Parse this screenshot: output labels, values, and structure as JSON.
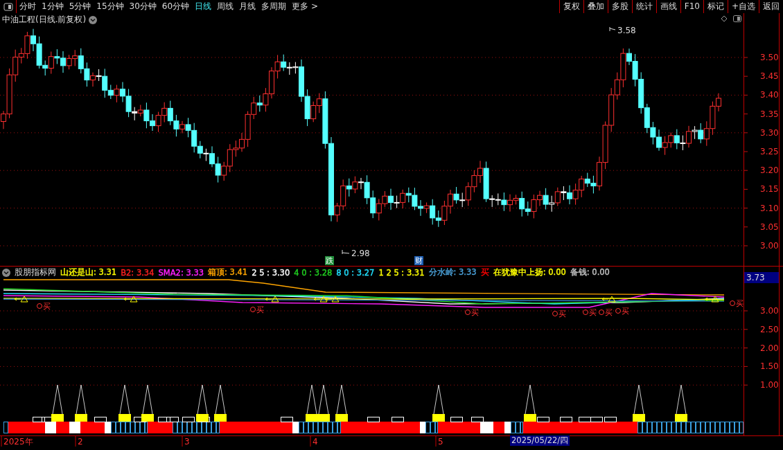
{
  "toolbar": {
    "periods": [
      {
        "label": "分时",
        "selected": false
      },
      {
        "label": "1分钟",
        "selected": false
      },
      {
        "label": "5分钟",
        "selected": false
      },
      {
        "label": "15分钟",
        "selected": false
      },
      {
        "label": "30分钟",
        "selected": false
      },
      {
        "label": "60分钟",
        "selected": false
      },
      {
        "label": "日线",
        "selected": true
      },
      {
        "label": "周线",
        "selected": false
      },
      {
        "label": "月线",
        "selected": false
      },
      {
        "label": "多周期",
        "selected": false
      },
      {
        "label": "更多 >",
        "selected": false
      }
    ],
    "buttons": [
      "复权",
      "叠加",
      "多股",
      "统计",
      "画线",
      "F10",
      "标记",
      "+自选",
      "返回"
    ]
  },
  "main_chart": {
    "title": "中油工程(日线.前复权)",
    "price_axis": [
      "3.50",
      "3.45",
      "3.40",
      "3.35",
      "3.30",
      "3.25",
      "3.20",
      "3.15",
      "3.10",
      "3.05",
      "3.00"
    ],
    "high_label": "3.58",
    "low_label": "2.98",
    "badges": [
      {
        "text": "跌",
        "color": "#1f8f3a"
      },
      {
        "text": "财",
        "color": "#1e5fb4"
      }
    ]
  },
  "indicator": {
    "name": "股朋指标网",
    "legend": [
      {
        "text": "山还是山: 3.31",
        "color": "#ffff00"
      },
      {
        "text": "B2: 3.34",
        "color": "#ff2020"
      },
      {
        "text": "SMA2: 3.33",
        "color": "#ff20ff"
      },
      {
        "text": "箱顶: 3.41",
        "color": "#ffa500"
      },
      {
        "text": "2 5 : 3.30",
        "color": "#ffffff"
      },
      {
        "text": "4 0 : 3.28",
        "color": "#20d020"
      },
      {
        "text": "8 0 : 3.27",
        "color": "#20e0ff"
      },
      {
        "text": "1 2 5 : 3.31",
        "color": "#ffff00"
      },
      {
        "text": "分水岭: 3.33",
        "color": "#4aa0d8"
      },
      {
        "text": "买",
        "color": "#ff0000"
      },
      {
        "text": "在犹豫中上扬: 0.00",
        "color": "#ffff00"
      },
      {
        "text": "备钱: 0.00",
        "color": "#c0c0c0"
      }
    ],
    "current_value": "3.73",
    "value_axis": [
      "3.00",
      "2.50",
      "2.00",
      "1.50",
      "1.00"
    ],
    "signals": [
      {
        "text": "买"
      },
      {
        "text": "买"
      },
      {
        "text": "买"
      },
      {
        "text": "买"
      },
      {
        "text": "买"
      },
      {
        "text": "买"
      },
      {
        "text": "买"
      },
      {
        "text": "买"
      }
    ]
  },
  "date_axis": {
    "labels": [
      "2025年",
      "2",
      "3",
      "4",
      "5"
    ],
    "cursor_date": "2025/05/22/四"
  }
}
